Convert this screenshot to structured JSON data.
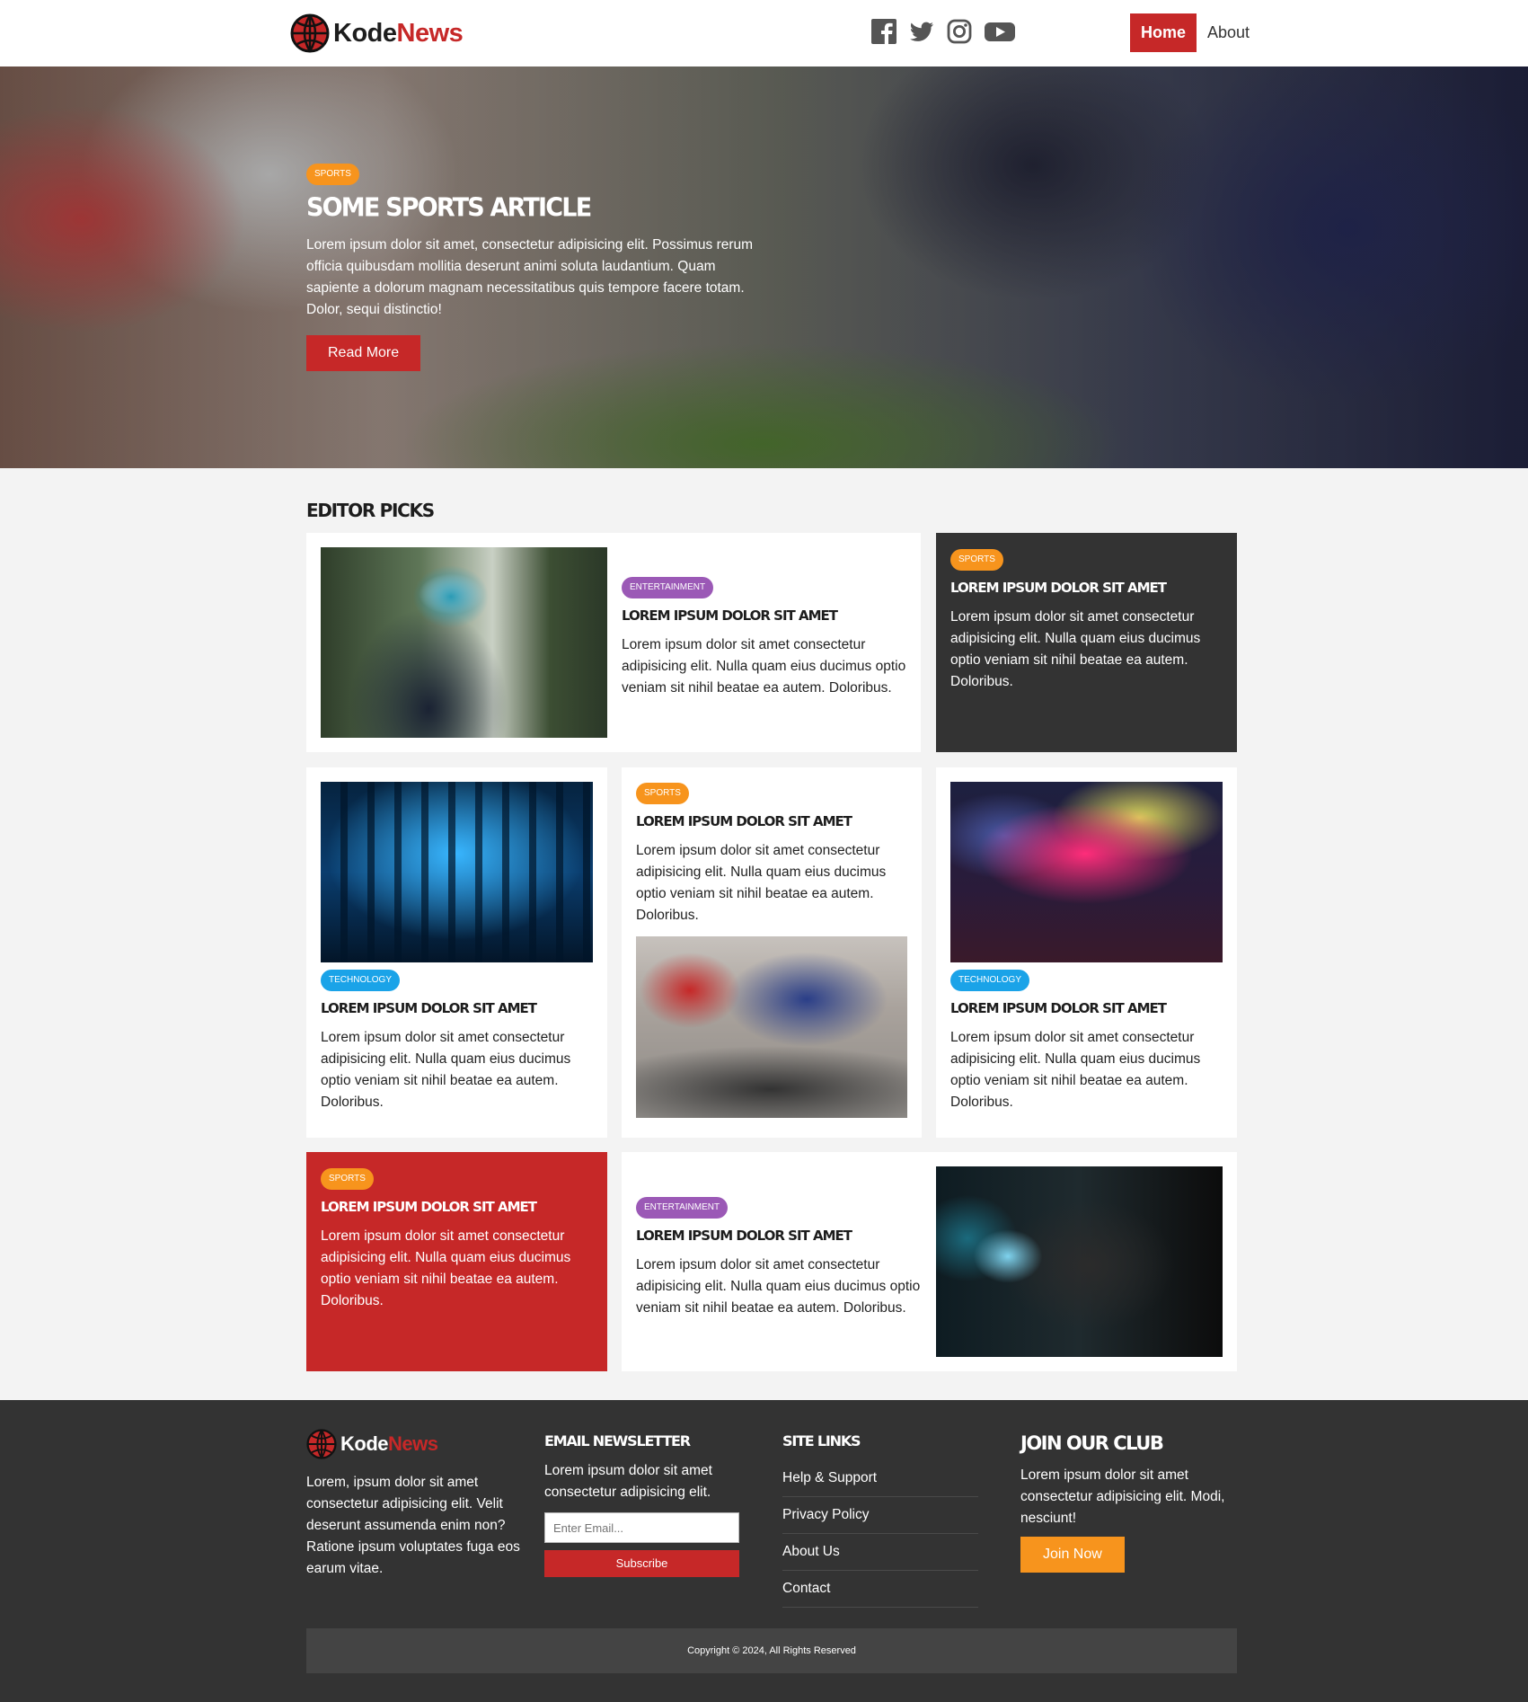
{
  "brand": {
    "name_part1": "Kode",
    "name_part2": "News",
    "accent": "#c62828",
    "orange": "#f7941d",
    "dark": "#333333"
  },
  "social": [
    {
      "icon": "facebook-icon"
    },
    {
      "icon": "twitter-icon"
    },
    {
      "icon": "instagram-icon"
    },
    {
      "icon": "youtube-icon"
    }
  ],
  "nav": {
    "home": "Home",
    "about": "About"
  },
  "hero": {
    "badge": "SPORTS",
    "title": "SOME SPORTS ARTICLE",
    "text": "Lorem ipsum dolor sit amet, consectetur adipisicing elit. Possimus rerum officia quibusdam mollitia deserunt animi soluta laudantium. Quam sapiente a dolorum magnam necessitatibus quis tempore facere totam. Dolor, sequi distinctio!",
    "button": "Read More"
  },
  "picks": {
    "heading": "EDITOR PICKS",
    "cards": [
      {
        "badge": "ENTERTAINMENT",
        "title": "LOREM IPSUM DOLOR SIT AMET",
        "text": "Lorem ipsum dolor sit amet consectetur adipisicing elit. Nulla quam eius ducimus optio veniam sit nihil beatae ea autem. Doloribus."
      },
      {
        "badge": "SPORTS",
        "title": "LOREM IPSUM DOLOR SIT AMET",
        "text": "Lorem ipsum dolor sit amet consectetur adipisicing elit. Nulla quam eius ducimus optio veniam sit nihil beatae ea autem. Doloribus."
      },
      {
        "badge": "TECHNOLOGY",
        "title": "LOREM IPSUM DOLOR SIT AMET",
        "text": "Lorem ipsum dolor sit amet consectetur adipisicing elit. Nulla quam eius ducimus optio veniam sit nihil beatae ea autem. Doloribus."
      },
      {
        "badge": "SPORTS",
        "title": "LOREM IPSUM DOLOR SIT AMET",
        "text": "Lorem ipsum dolor sit amet consectetur adipisicing elit. Nulla quam eius ducimus optio veniam sit nihil beatae ea autem. Doloribus."
      },
      {
        "badge": "TECHNOLOGY",
        "title": "LOREM IPSUM DOLOR SIT AMET",
        "text": "Lorem ipsum dolor sit amet consectetur adipisicing elit. Nulla quam eius ducimus optio veniam sit nihil beatae ea autem. Doloribus."
      },
      {
        "badge": "SPORTS",
        "title": "LOREM IPSUM DOLOR SIT AMET",
        "text": "Lorem ipsum dolor sit amet consectetur adipisicing elit. Nulla quam eius ducimus optio veniam sit nihil beatae ea autem. Doloribus."
      },
      {
        "badge": "ENTERTAINMENT",
        "title": "LOREM IPSUM DOLOR SIT AMET",
        "text": "Lorem ipsum dolor sit amet consectetur adipisicing elit. Nulla quam eius ducimus optio veniam sit nihil beatae ea autem. Doloribus."
      }
    ]
  },
  "footer": {
    "about_text": "Lorem, ipsum dolor sit amet consectetur adipisicing elit. Velit deserunt assumenda enim non? Ratione ipsum voluptates fuga eos earum vitae.",
    "newsletter": {
      "heading": "EMAIL NEWSLETTER",
      "text": "Lorem ipsum dolor sit amet consectetur adipisicing elit.",
      "placeholder": "Enter Email...",
      "button": "Subscribe"
    },
    "site_links": {
      "heading": "SITE LINKS",
      "items": [
        "Help & Support",
        "Privacy Policy",
        "About Us",
        "Contact"
      ]
    },
    "club": {
      "heading": "JOIN OUR CLUB",
      "text": "Lorem ipsum dolor sit amet consectetur adipisicing elit. Modi, nesciunt!",
      "button": "Join Now"
    },
    "copyright": "Copyright © 2024, All Rights Reserved"
  }
}
